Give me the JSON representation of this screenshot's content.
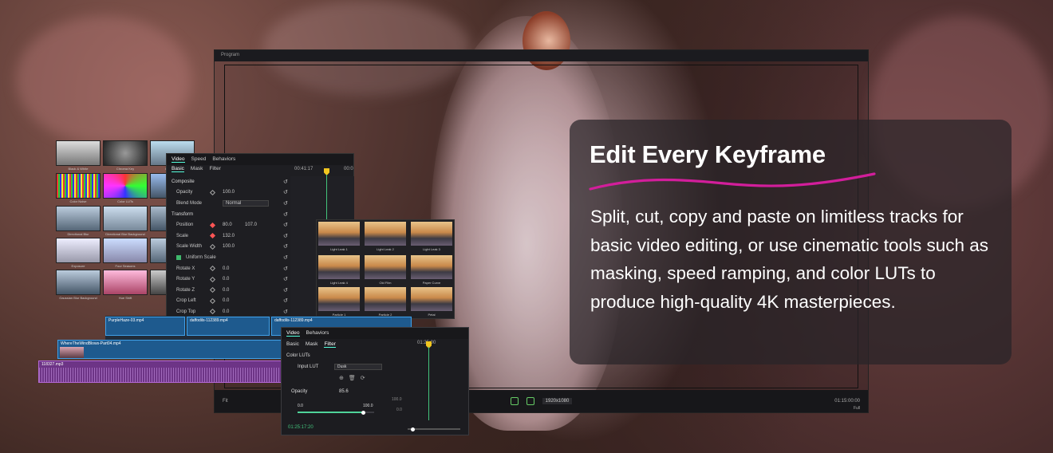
{
  "hero": {
    "title": "Edit Every Keyframe",
    "body": "Split, cut, copy and paste on limitless tracks for basic video editing, or use cinematic tools such as masking, speed ramping, and color LUTs to produce high-quality 4K masterpieces.",
    "accent_color": "#d21e9b"
  },
  "program": {
    "title": "Program",
    "resolution": "1920x1080",
    "timecode": "01:15:00:00",
    "fit": "Fit",
    "full": "Full"
  },
  "effects": {
    "items": [
      "Black & White",
      "Chroma Key",
      "Color Grid",
      "Color Noise",
      "Color LUTs",
      "",
      "Directional Blur",
      "Directional Blur Background",
      "",
      "Exposure",
      "Four Seasons",
      "",
      "Gaussian Blur Background",
      "Hue Shift",
      ""
    ]
  },
  "video_panel": {
    "tabs": [
      "Video",
      "Speed",
      "Behaviors"
    ],
    "subtabs": [
      "Basic",
      "Mask",
      "Filter"
    ],
    "timecode": "00:41:17",
    "timecode2": "00:0",
    "rows": [
      {
        "label": "Composite",
        "section": true
      },
      {
        "label": "Opacity",
        "v1": "100.0"
      },
      {
        "label": "Blend Mode",
        "v1": "Normal"
      },
      {
        "label": "Transform",
        "section": true
      },
      {
        "label": "Position",
        "v1": "80.0",
        "v2": "107.0"
      },
      {
        "label": "Scale",
        "v1": "132.0"
      },
      {
        "label": "Scale Width",
        "v1": "100.0"
      },
      {
        "label": "Uniform Scale",
        "v1": ""
      },
      {
        "label": "Rotate X",
        "v1": "0.0"
      },
      {
        "label": "Rotate Y",
        "v1": "0.0"
      },
      {
        "label": "Rotate Z",
        "v1": "0.0"
      },
      {
        "label": "Crop Left",
        "v1": "0.0"
      },
      {
        "label": "Crop Top",
        "v1": "0.0"
      }
    ]
  },
  "filters": {
    "items": [
      "Light Leak 1",
      "Light Leak 2",
      "Light Leak 3",
      "Light Leak 4",
      "Old Film",
      "Paper Curve",
      "Particle 1",
      "Particle 2",
      "Petal"
    ]
  },
  "timeline": {
    "clips": [
      "PurpleHaze-03.mp4",
      "daffodils-112389.mp4",
      "daffodils-112389.mp4"
    ],
    "clip2": "WhereTheWindBlows-Part04.mp4",
    "audio": "118327.mp3"
  },
  "filter_panel": {
    "tabs": [
      "Video",
      "Behaviors"
    ],
    "subtabs": [
      "Basic",
      "Mask",
      "Filter"
    ],
    "timecode": "01:25:00",
    "section": "Color LUTs",
    "input_lut_label": "Input LUT",
    "input_lut_value": "Dusk",
    "opacity_label": "Opacity",
    "opacity_value": "85.6",
    "min": "0.0",
    "max": "100.0",
    "right_max": "100.0",
    "right_min": "0.0",
    "opacity_fraction": 0.856,
    "footer_time": "01:25:17:20"
  }
}
